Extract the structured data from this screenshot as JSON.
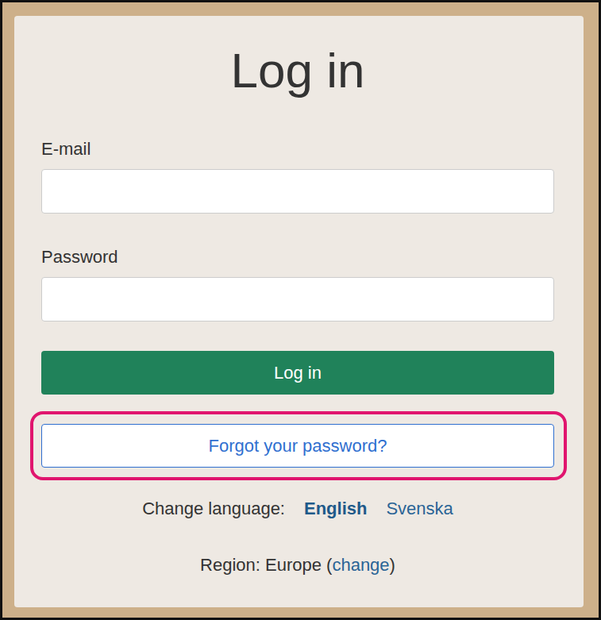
{
  "title": "Log in",
  "fields": [
    {
      "label": "E-mail",
      "value": "",
      "kind": "text"
    },
    {
      "label": "Password",
      "value": "",
      "kind": "password"
    }
  ],
  "login_button": "Log in",
  "forgot_button": {
    "label": "Forgot your password?",
    "highlighted": true
  },
  "language": {
    "label": "Change language:",
    "options": [
      {
        "label": "English",
        "selected": true
      },
      {
        "label": "Svenska",
        "selected": false
      }
    ]
  },
  "region": {
    "before": "Region: Europe (",
    "link": "change",
    "after": ")"
  }
}
